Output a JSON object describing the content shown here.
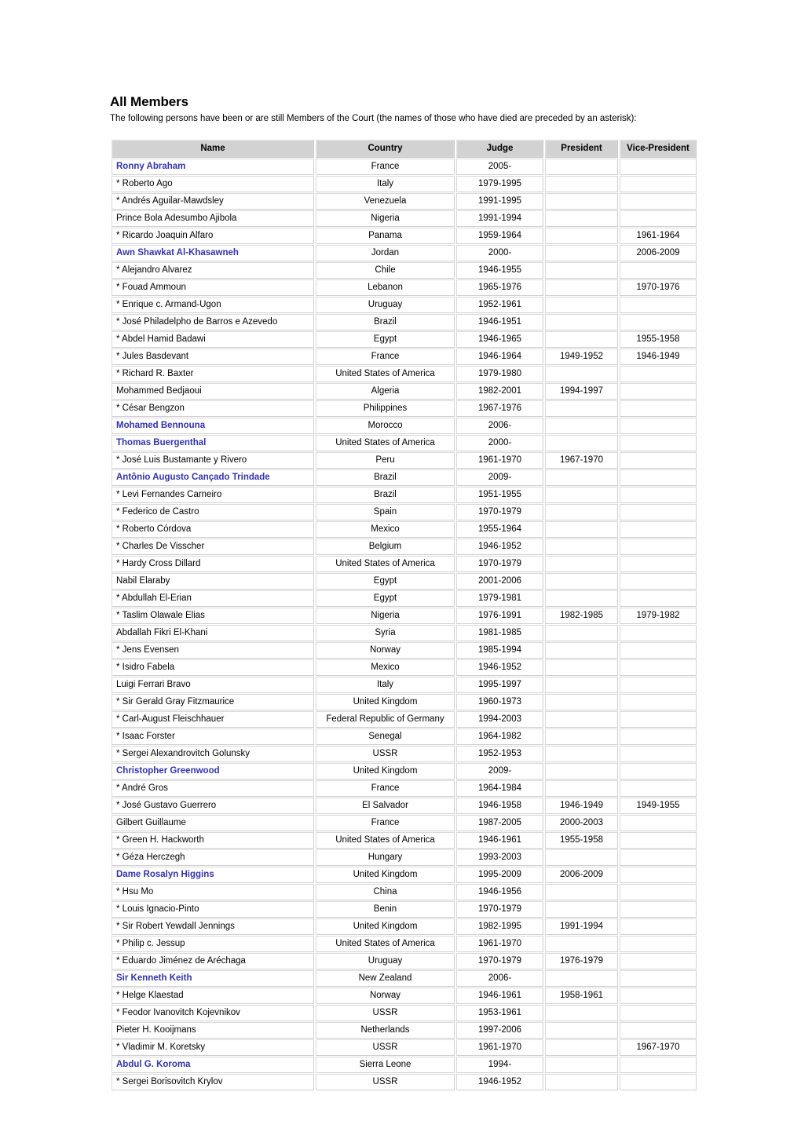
{
  "header": {
    "title": "All Members",
    "intro": "The following persons have been or are still Members of the Court (the names of those who have died are preceded by an asterisk):"
  },
  "colors": {
    "link": "#3333aa",
    "header_bg": "#cccccc",
    "cell_border": "#cfcfcf",
    "text": "#000000"
  },
  "table": {
    "columns": [
      "Name",
      "Country",
      "Judge",
      "President",
      "Vice-President"
    ],
    "rows": [
      {
        "name": "Ronny Abraham",
        "link": true,
        "country": "France",
        "judge": "2005-",
        "president": "",
        "vice_president": ""
      },
      {
        "name": "* Roberto Ago",
        "link": false,
        "country": "Italy",
        "judge": "1979-1995",
        "president": "",
        "vice_president": ""
      },
      {
        "name": "* Andrés Aguilar-Mawdsley",
        "link": false,
        "country": "Venezuela",
        "judge": "1991-1995",
        "president": "",
        "vice_president": ""
      },
      {
        "name": "Prince Bola Adesumbo Ajibola",
        "link": false,
        "country": "Nigeria",
        "judge": "1991-1994",
        "president": "",
        "vice_president": ""
      },
      {
        "name": "* Ricardo Joaquin Alfaro",
        "link": false,
        "country": "Panama",
        "judge": "1959-1964",
        "president": "",
        "vice_president": "1961-1964"
      },
      {
        "name": "Awn Shawkat Al-Khasawneh",
        "link": true,
        "country": "Jordan",
        "judge": "2000-",
        "president": "",
        "vice_president": "2006-2009"
      },
      {
        "name": "* Alejandro Alvarez",
        "link": false,
        "country": "Chile",
        "judge": "1946-1955",
        "president": "",
        "vice_president": ""
      },
      {
        "name": "* Fouad Ammoun",
        "link": false,
        "country": "Lebanon",
        "judge": "1965-1976",
        "president": "",
        "vice_president": "1970-1976"
      },
      {
        "name": "* Enrique c. Armand-Ugon",
        "link": false,
        "country": "Uruguay",
        "judge": "1952-1961",
        "president": "",
        "vice_president": ""
      },
      {
        "name": "* José Philadelpho de Barros e Azevedo",
        "link": false,
        "country": "Brazil",
        "judge": "1946-1951",
        "president": "",
        "vice_president": ""
      },
      {
        "name": "* Abdel Hamid Badawi",
        "link": false,
        "country": "Egypt",
        "judge": "1946-1965",
        "president": "",
        "vice_president": "1955-1958"
      },
      {
        "name": "* Jules Basdevant",
        "link": false,
        "country": "France",
        "judge": "1946-1964",
        "president": "1949-1952",
        "vice_president": "1946-1949"
      },
      {
        "name": "* Richard R. Baxter",
        "link": false,
        "country": "United States of America",
        "judge": "1979-1980",
        "president": "",
        "vice_president": ""
      },
      {
        "name": "Mohammed Bedjaoui",
        "link": false,
        "country": "Algeria",
        "judge": "1982-2001",
        "president": "1994-1997",
        "vice_president": ""
      },
      {
        "name": "* César Bengzon",
        "link": false,
        "country": "Philippines",
        "judge": "1967-1976",
        "president": "",
        "vice_president": ""
      },
      {
        "name": "Mohamed Bennouna",
        "link": true,
        "country": "Morocco",
        "judge": "2006-",
        "president": "",
        "vice_president": ""
      },
      {
        "name": "Thomas Buergenthal",
        "link": true,
        "country": "United States of America",
        "judge": "2000-",
        "president": "",
        "vice_president": ""
      },
      {
        "name": "* José Luis Bustamante y Rivero",
        "link": false,
        "country": "Peru",
        "judge": "1961-1970",
        "president": "1967-1970",
        "vice_president": ""
      },
      {
        "name": "Antônio Augusto Cançado Trindade",
        "link": true,
        "country": "Brazil",
        "judge": "2009-",
        "president": "",
        "vice_president": ""
      },
      {
        "name": "* Levi Fernandes Carneiro",
        "link": false,
        "country": "Brazil",
        "judge": "1951-1955",
        "president": "",
        "vice_president": ""
      },
      {
        "name": "* Federico de Castro",
        "link": false,
        "country": "Spain",
        "judge": "1970-1979",
        "president": "",
        "vice_president": ""
      },
      {
        "name": "* Roberto Córdova",
        "link": false,
        "country": "Mexico",
        "judge": "1955-1964",
        "president": "",
        "vice_president": ""
      },
      {
        "name": "* Charles De Visscher",
        "link": false,
        "country": "Belgium",
        "judge": "1946-1952",
        "president": "",
        "vice_president": ""
      },
      {
        "name": "* Hardy Cross Dillard",
        "link": false,
        "country": "United States of America",
        "judge": "1970-1979",
        "president": "",
        "vice_president": ""
      },
      {
        "name": "Nabil Elaraby",
        "link": false,
        "country": "Egypt",
        "judge": "2001-2006",
        "president": "",
        "vice_president": ""
      },
      {
        "name": "* Abdullah El-Erian",
        "link": false,
        "country": "Egypt",
        "judge": "1979-1981",
        "president": "",
        "vice_president": ""
      },
      {
        "name": "* Taslim Olawale Elias",
        "link": false,
        "country": "Nigeria",
        "judge": "1976-1991",
        "president": "1982-1985",
        "vice_president": "1979-1982"
      },
      {
        "name": "Abdallah Fikri El-Khani",
        "link": false,
        "country": "Syria",
        "judge": "1981-1985",
        "president": "",
        "vice_president": ""
      },
      {
        "name": "* Jens Evensen",
        "link": false,
        "country": "Norway",
        "judge": "1985-1994",
        "president": "",
        "vice_president": ""
      },
      {
        "name": "* Isidro Fabela",
        "link": false,
        "country": "Mexico",
        "judge": "1946-1952",
        "president": "",
        "vice_president": ""
      },
      {
        "name": "Luigi Ferrari Bravo",
        "link": false,
        "country": "Italy",
        "judge": "1995-1997",
        "president": "",
        "vice_president": ""
      },
      {
        "name": "* Sir Gerald Gray Fitzmaurice",
        "link": false,
        "country": "United Kingdom",
        "judge": "1960-1973",
        "president": "",
        "vice_president": ""
      },
      {
        "name": "* Carl-August Fleischhauer",
        "link": false,
        "country": "Federal Republic of Germany",
        "judge": "1994-2003",
        "president": "",
        "vice_president": ""
      },
      {
        "name": "* Isaac Forster",
        "link": false,
        "country": "Senegal",
        "judge": "1964-1982",
        "president": "",
        "vice_president": ""
      },
      {
        "name": "* Sergei Alexandrovitch Golunsky",
        "link": false,
        "country": "USSR",
        "judge": "1952-1953",
        "president": "",
        "vice_president": ""
      },
      {
        "name": "Christopher Greenwood",
        "link": true,
        "country": "United Kingdom",
        "judge": "2009-",
        "president": "",
        "vice_president": ""
      },
      {
        "name": "* André Gros",
        "link": false,
        "country": "France",
        "judge": "1964-1984",
        "president": "",
        "vice_president": ""
      },
      {
        "name": "* José Gustavo Guerrero",
        "link": false,
        "country": "El Salvador",
        "judge": "1946-1958",
        "president": "1946-1949",
        "vice_president": "1949-1955"
      },
      {
        "name": "Gilbert Guillaume",
        "link": false,
        "country": "France",
        "judge": "1987-2005",
        "president": "2000-2003",
        "vice_president": ""
      },
      {
        "name": "* Green H. Hackworth",
        "link": false,
        "country": "United States of America",
        "judge": "1946-1961",
        "president": "1955-1958",
        "vice_president": ""
      },
      {
        "name": "* Géza Herczegh",
        "link": false,
        "country": "Hungary",
        "judge": "1993-2003",
        "president": "",
        "vice_president": ""
      },
      {
        "name": "Dame Rosalyn Higgins",
        "link": true,
        "country": "United Kingdom",
        "judge": "1995-2009",
        "president": "2006-2009",
        "vice_president": ""
      },
      {
        "name": "* Hsu Mo",
        "link": false,
        "country": "China",
        "judge": "1946-1956",
        "president": "",
        "vice_president": ""
      },
      {
        "name": "* Louis Ignacio-Pinto",
        "link": false,
        "country": "Benin",
        "judge": "1970-1979",
        "president": "",
        "vice_president": ""
      },
      {
        "name": "* Sir Robert Yewdall Jennings",
        "link": false,
        "country": "United Kingdom",
        "judge": "1982-1995",
        "president": "1991-1994",
        "vice_president": ""
      },
      {
        "name": "* Philip c. Jessup",
        "link": false,
        "country": "United States of America",
        "judge": "1961-1970",
        "president": "",
        "vice_president": ""
      },
      {
        "name": "* Eduardo Jiménez de Aréchaga",
        "link": false,
        "country": "Uruguay",
        "judge": "1970-1979",
        "president": "1976-1979",
        "vice_president": ""
      },
      {
        "name": "Sir Kenneth Keith",
        "link": true,
        "country": "New Zealand",
        "judge": "2006-",
        "president": "",
        "vice_president": ""
      },
      {
        "name": "* Helge Klaestad",
        "link": false,
        "country": "Norway",
        "judge": "1946-1961",
        "president": "1958-1961",
        "vice_president": ""
      },
      {
        "name": "* Feodor Ivanovitch Kojevnikov",
        "link": false,
        "country": "USSR",
        "judge": "1953-1961",
        "president": "",
        "vice_president": ""
      },
      {
        "name": "Pieter H. Kooijmans",
        "link": false,
        "country": "Netherlands",
        "judge": "1997-2006",
        "president": "",
        "vice_president": ""
      },
      {
        "name": "* Vladimir M. Koretsky",
        "link": false,
        "country": "USSR",
        "judge": "1961-1970",
        "president": "",
        "vice_president": "1967-1970"
      },
      {
        "name": "Abdul G. Koroma",
        "link": true,
        "country": "Sierra Leone",
        "judge": "1994-",
        "president": "",
        "vice_president": ""
      },
      {
        "name": "* Sergei Borisovitch Krylov",
        "link": false,
        "country": "USSR",
        "judge": "1946-1952",
        "president": "",
        "vice_president": ""
      }
    ]
  }
}
